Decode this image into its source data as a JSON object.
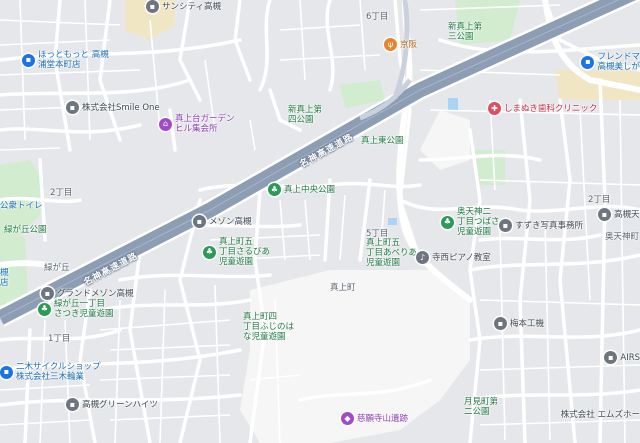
{
  "colors": {
    "highway": "#8d9db3",
    "road": "#ffffff",
    "block": "#e6e7ea",
    "park": "#d2eccf",
    "background": "#f1f2f3",
    "water": "#aad3f5",
    "school": "#f3e8c6"
  },
  "highway_labels": [
    "名神高速道路",
    "名神高速道路"
  ],
  "pois": [
    {
      "label": "サンシティ高槻",
      "icon": "building-icon",
      "kind": "grey"
    },
    {
      "label": "ほっともっと 高槻\n浦堂本町店",
      "icon": "shop-icon",
      "kind": "blue"
    },
    {
      "label": "新真上第\n三公園",
      "icon": "",
      "kind": "park"
    },
    {
      "label": "6丁目",
      "icon": "",
      "kind": "area"
    },
    {
      "label": "京阪",
      "icon": "restaurant-icon",
      "kind": "orange"
    },
    {
      "label": "フレンドマ\n高槻美しが",
      "icon": "shop-icon",
      "kind": "blue"
    },
    {
      "label": "株式会社Smile One",
      "icon": "building-icon",
      "kind": "grey"
    },
    {
      "label": "真上台ガーデン\nヒル集会所",
      "icon": "community-icon",
      "kind": "purple"
    },
    {
      "label": "新真上第\n四公園",
      "icon": "",
      "kind": "park"
    },
    {
      "label": "しまぬき歯科クリニック",
      "icon": "clinic-icon",
      "kind": "red"
    },
    {
      "label": "真上東公園",
      "icon": "",
      "kind": "park"
    },
    {
      "label": "真上中央公園",
      "icon": "park-icon",
      "kind": "green"
    },
    {
      "label": "2丁目",
      "icon": "",
      "kind": "area"
    },
    {
      "label": "公衆トイレ",
      "icon": "",
      "kind": "blue"
    },
    {
      "label": "緑が丘公園",
      "icon": "",
      "kind": "park"
    },
    {
      "label": "2丁目",
      "icon": "",
      "kind": "area"
    },
    {
      "label": "奥天神二\n丁目つばさ\n児童遊園",
      "icon": "park-icon",
      "kind": "green"
    },
    {
      "label": "高槻天",
      "icon": "building-icon",
      "kind": "grey"
    },
    {
      "label": "すずき写真事務所",
      "icon": "building-icon",
      "kind": "grey"
    },
    {
      "label": "メゾン高槻",
      "icon": "building-icon",
      "kind": "grey"
    },
    {
      "label": "真上町五\n丁目さるびあ\n児童遊園",
      "icon": "park-icon",
      "kind": "green"
    },
    {
      "label": "5丁目",
      "icon": "",
      "kind": "area"
    },
    {
      "label": "真上町五\n丁目あべりあ\n児童遊園",
      "icon": "",
      "kind": "park"
    },
    {
      "label": "寺西ピアノ教室",
      "icon": "school-icon",
      "kind": "grey"
    },
    {
      "label": "奥天神町",
      "icon": "",
      "kind": "area"
    },
    {
      "label": "緑が丘",
      "icon": "",
      "kind": "area"
    },
    {
      "label": "槻\n店",
      "icon": "",
      "kind": "blue"
    },
    {
      "label": "真上町",
      "icon": "",
      "kind": "area"
    },
    {
      "label": "グランドメゾン高槻",
      "icon": "building-icon",
      "kind": "grey"
    },
    {
      "label": "緑が丘一丁目\nさつき児童遊園",
      "icon": "park-icon",
      "kind": "green"
    },
    {
      "label": "真上町四\n丁目ふじのは\nな児童遊園",
      "icon": "",
      "kind": "park"
    },
    {
      "label": "梅本工機",
      "icon": "building-icon",
      "kind": "grey"
    },
    {
      "label": "1丁目",
      "icon": "",
      "kind": "area"
    },
    {
      "label": "二木サイクルショップ\n株式会社三木輪業",
      "icon": "shop-icon",
      "kind": "blue"
    },
    {
      "label": "AIRS",
      "icon": "building-icon",
      "kind": "grey"
    },
    {
      "label": "高槻グリーンハイツ",
      "icon": "building-icon",
      "kind": "grey"
    },
    {
      "label": "月見町第\n二公園",
      "icon": "",
      "kind": "park"
    },
    {
      "label": "慈願寺山遺跡",
      "icon": "landmark-icon",
      "kind": "purple"
    },
    {
      "label": "株式会社 エムズホー",
      "icon": "",
      "kind": "grey"
    }
  ]
}
